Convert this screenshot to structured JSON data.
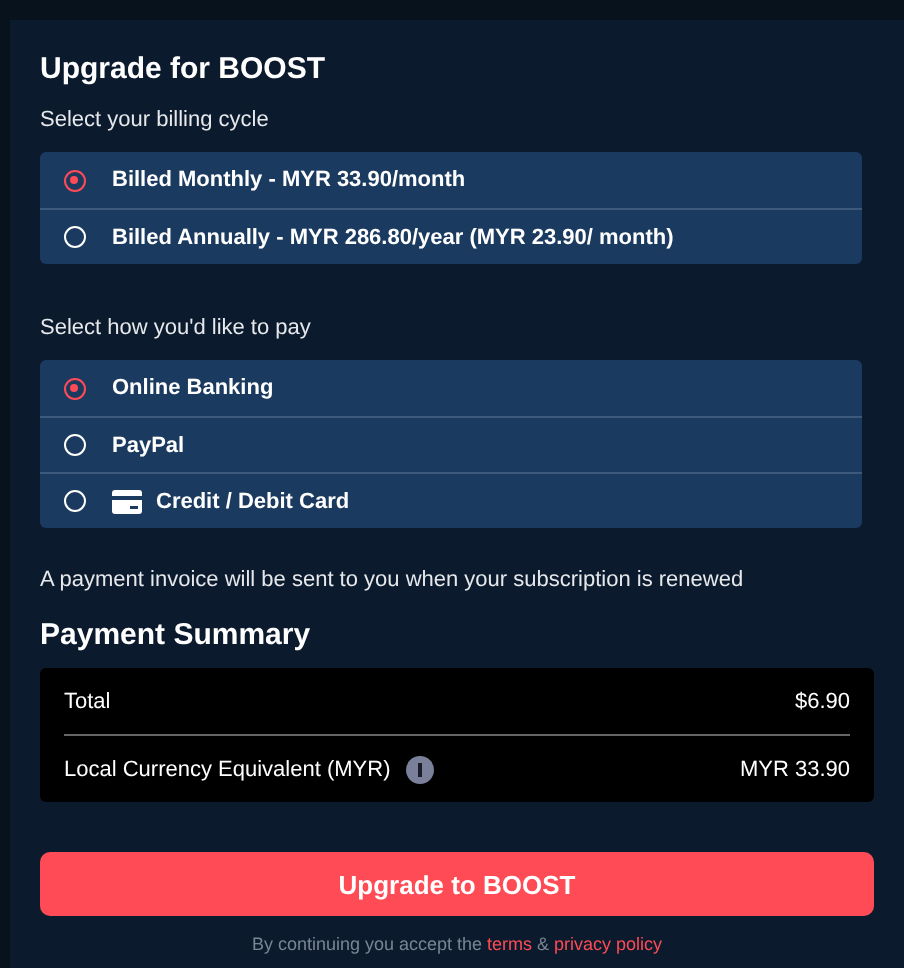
{
  "title": "Upgrade for BOOST",
  "billing": {
    "prompt": "Select your billing cycle",
    "options": [
      {
        "label": "Billed Monthly - MYR 33.90/month",
        "selected": true,
        "kind": "plain"
      },
      {
        "label": "Billed Annually - MYR 286.80/year (MYR 23.90/ month)",
        "selected": false,
        "kind": "plain"
      }
    ]
  },
  "payment": {
    "prompt": "Select how you'd like to pay",
    "options": [
      {
        "label": "Online Banking",
        "selected": true,
        "kind": "plain"
      },
      {
        "label": "PayPal",
        "selected": false,
        "kind": "plain"
      },
      {
        "label": "Credit / Debit Card",
        "selected": false,
        "kind": "card"
      }
    ]
  },
  "note": "A payment invoice will be sent to you when your subscription is renewed",
  "summary": {
    "title": "Payment Summary",
    "rows": [
      {
        "label": "Total",
        "value": "$6.90",
        "info": false
      },
      {
        "label": "Local Currency Equivalent (MYR)",
        "value": "MYR 33.90",
        "info": true
      }
    ]
  },
  "button": "Upgrade to BOOST",
  "footer": {
    "lead": "By continuing you accept the",
    "links": [
      "terms",
      "privacy policy"
    ],
    "joiner": "&"
  }
}
